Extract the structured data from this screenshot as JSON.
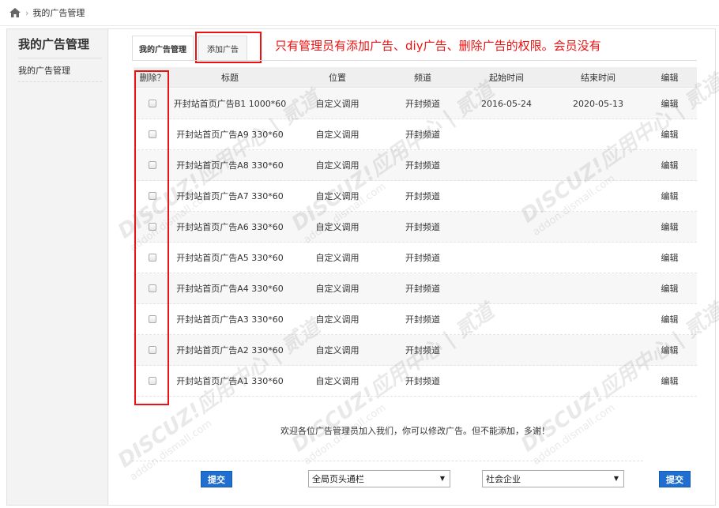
{
  "breadcrumb": {
    "current": "我的广告管理"
  },
  "sidebar": {
    "title": "我的广告管理",
    "items": [
      {
        "label": "我的广告管理"
      }
    ]
  },
  "tabs": [
    {
      "label": "我的广告管理",
      "active": true
    },
    {
      "label": "添加广告",
      "active": false
    }
  ],
  "annotation": "只有管理员有添加广告、diy广告、删除广告的权限。会员没有",
  "table": {
    "headers": [
      "删除？",
      "标题",
      "位置",
      "频道",
      "起始时间",
      "结束时间",
      "编辑"
    ],
    "rows": [
      {
        "title": "开封站首页广告B1 1000*60",
        "position": "自定义调用",
        "channel": "开封频道",
        "start": "2016-05-24",
        "end": "2020-05-13",
        "action": "编辑"
      },
      {
        "title": "开封站首页广告A9 330*60",
        "position": "自定义调用",
        "channel": "开封频道",
        "start": "",
        "end": "",
        "action": "编辑"
      },
      {
        "title": "开封站首页广告A8 330*60",
        "position": "自定义调用",
        "channel": "开封频道",
        "start": "",
        "end": "",
        "action": "编辑"
      },
      {
        "title": "开封站首页广告A7 330*60",
        "position": "自定义调用",
        "channel": "开封频道",
        "start": "",
        "end": "",
        "action": "编辑"
      },
      {
        "title": "开封站首页广告A6 330*60",
        "position": "自定义调用",
        "channel": "开封频道",
        "start": "",
        "end": "",
        "action": "编辑"
      },
      {
        "title": "开封站首页广告A5 330*60",
        "position": "自定义调用",
        "channel": "开封频道",
        "start": "",
        "end": "",
        "action": "编辑"
      },
      {
        "title": "开封站首页广告A4 330*60",
        "position": "自定义调用",
        "channel": "开封频道",
        "start": "",
        "end": "",
        "action": "编辑"
      },
      {
        "title": "开封站首页广告A3 330*60",
        "position": "自定义调用",
        "channel": "开封频道",
        "start": "",
        "end": "",
        "action": "编辑"
      },
      {
        "title": "开封站首页广告A2 330*60",
        "position": "自定义调用",
        "channel": "开封频道",
        "start": "",
        "end": "",
        "action": "编辑"
      },
      {
        "title": "开封站首页广告A1 330*60",
        "position": "自定义调用",
        "channel": "开封频道",
        "start": "",
        "end": "",
        "action": "编辑"
      }
    ]
  },
  "footer_note": "欢迎各位广告管理员加入我们，你可以修改广告。但不能添加，多谢！",
  "form": {
    "submit_left": "提交",
    "position_select": "全局页头通栏",
    "category_select": "社会企业",
    "submit_right": "提交"
  },
  "watermark": {
    "brand": "DISCUZ!应用中心 | 贰道",
    "url": "addon.dismall.com"
  },
  "colors": {
    "annotation_red": "#ee1111",
    "button_blue": "#1f6ed0"
  }
}
